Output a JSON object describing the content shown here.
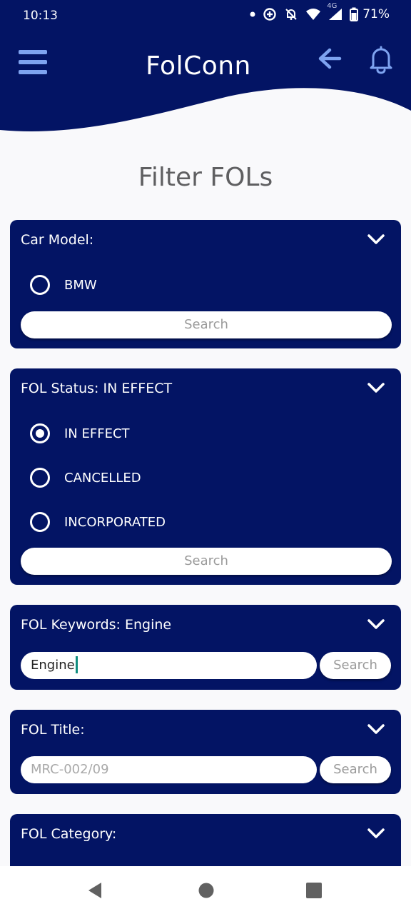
{
  "status_bar": {
    "time": "10:13",
    "network": "4G",
    "battery": "71%"
  },
  "header": {
    "app_title": "FolConn",
    "menu_icon": "hamburger-menu-icon",
    "back_icon": "arrow-left-icon",
    "notification_icon": "bell-icon"
  },
  "page": {
    "title": "Filter FOLs"
  },
  "filters": {
    "car_model": {
      "label": "Car Model:",
      "options": [
        {
          "label": "BMW",
          "selected": false
        }
      ],
      "search_label": "Search"
    },
    "status": {
      "label": "FOL Status: IN EFFECT",
      "options": [
        {
          "label": "IN EFFECT",
          "selected": true
        },
        {
          "label": "CANCELLED",
          "selected": false
        },
        {
          "label": "INCORPORATED",
          "selected": false
        }
      ],
      "search_label": "Search"
    },
    "keywords": {
      "label": "FOL Keywords: Engine",
      "value": "Engine",
      "search_label": "Search"
    },
    "title": {
      "label": "FOL Title:",
      "placeholder": "MRC-002/09",
      "search_label": "Search"
    },
    "category": {
      "label": "FOL Category:"
    }
  },
  "nav_bar": {
    "back_icon": "triangle-back-icon",
    "home_icon": "circle-home-icon",
    "recents_icon": "square-recents-icon"
  },
  "colors": {
    "primary": "#031464",
    "accent": "#7ea3f0",
    "background": "#f9f9fb",
    "title_text": "#5f5f61"
  }
}
